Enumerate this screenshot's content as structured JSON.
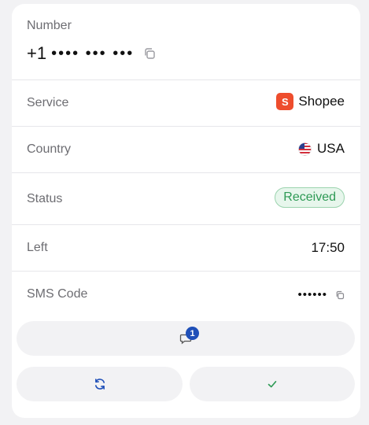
{
  "number": {
    "label": "Number",
    "country_code": "+1",
    "masked": "•••• ••• •••"
  },
  "details": {
    "service_label": "Service",
    "service_value": "Shopee",
    "service_logo_glyph": "S",
    "country_label": "Country",
    "country_value": "USA",
    "status_label": "Status",
    "status_value": "Received",
    "left_label": "Left",
    "left_value": "17:50",
    "sms_label": "SMS Code",
    "sms_value": "••••••"
  },
  "actions": {
    "messages_badge_count": "1"
  },
  "colors": {
    "brand_shopee": "#ee4d2d",
    "status_green": "#2e9a55",
    "badge_blue": "#1f4fb8",
    "action_icon": "#1f4fb8",
    "confirm_icon": "#2e9a55"
  },
  "icons": [
    "copy-icon",
    "shopee-logo",
    "us-flag-icon",
    "chat-icon",
    "refresh-icon",
    "check-icon"
  ]
}
